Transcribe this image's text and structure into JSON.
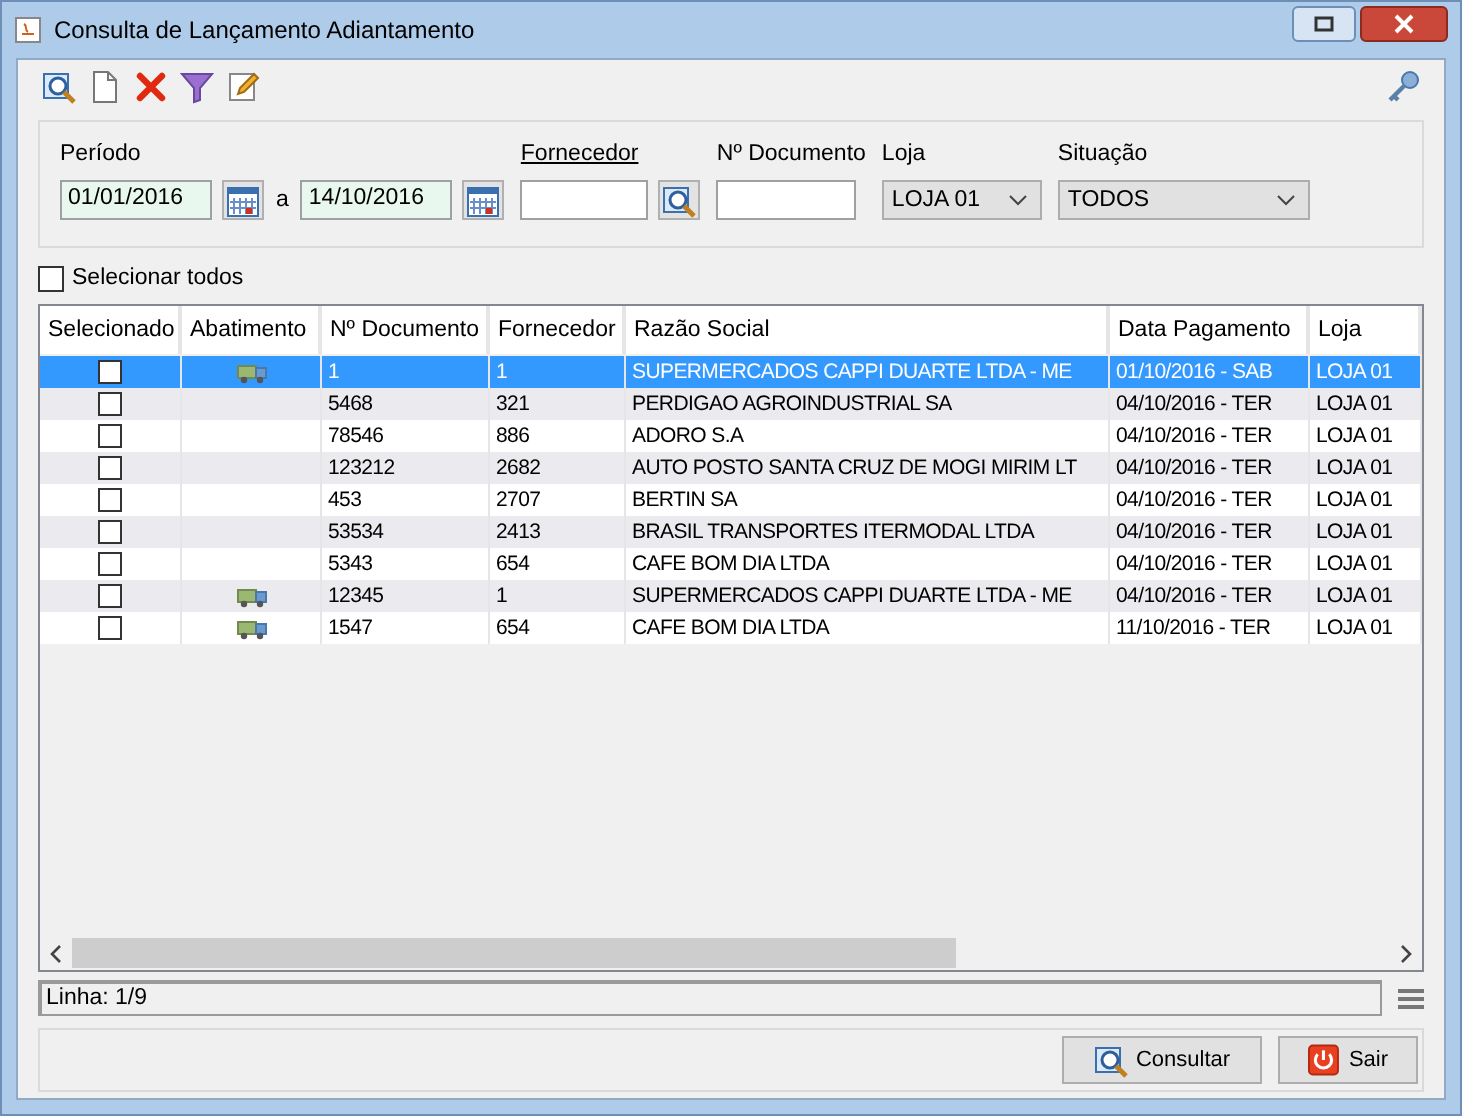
{
  "window": {
    "title": "Consulta de Lançamento Adiantamento"
  },
  "filters": {
    "periodo_label": "Período",
    "date_from": "01/01/2016",
    "between": "a",
    "date_to": "14/10/2016",
    "fornecedor_label": "Fornecedor",
    "documento_label": "Nº Documento",
    "loja_label": "Loja",
    "loja_value": "LOJA 01",
    "situacao_label": "Situação",
    "situacao_value": "TODOS"
  },
  "select_all": {
    "label": "Selecionar todos",
    "checked": false
  },
  "table": {
    "columns": [
      "Selecionado",
      "Abatimento",
      "Nº Documento",
      "Fornecedor",
      "Razão Social",
      "Data Pagamento",
      "Loja"
    ],
    "rows": [
      {
        "selected": true,
        "checked": false,
        "abatimento": true,
        "documento": "1",
        "fornecedor": "1",
        "razao": "SUPERMERCADOS CAPPI DUARTE LTDA - ME",
        "data": "01/10/2016 - SAB",
        "loja": "LOJA 01"
      },
      {
        "selected": false,
        "checked": false,
        "abatimento": false,
        "documento": "5468",
        "fornecedor": "321",
        "razao": "PERDIGAO AGROINDUSTRIAL SA",
        "data": "04/10/2016 - TER",
        "loja": "LOJA 01"
      },
      {
        "selected": false,
        "checked": false,
        "abatimento": false,
        "documento": "78546",
        "fornecedor": "886",
        "razao": "ADORO S.A",
        "data": "04/10/2016 - TER",
        "loja": "LOJA 01"
      },
      {
        "selected": false,
        "checked": false,
        "abatimento": false,
        "documento": "123212",
        "fornecedor": "2682",
        "razao": "AUTO POSTO SANTA CRUZ DE MOGI MIRIM LT",
        "data": "04/10/2016 - TER",
        "loja": "LOJA 01"
      },
      {
        "selected": false,
        "checked": false,
        "abatimento": false,
        "documento": "453",
        "fornecedor": "2707",
        "razao": "BERTIN SA",
        "data": "04/10/2016 - TER",
        "loja": "LOJA 01"
      },
      {
        "selected": false,
        "checked": false,
        "abatimento": false,
        "documento": "53534",
        "fornecedor": "2413",
        "razao": "BRASIL TRANSPORTES ITERMODAL LTDA",
        "data": "04/10/2016 - TER",
        "loja": "LOJA 01"
      },
      {
        "selected": false,
        "checked": false,
        "abatimento": false,
        "documento": "5343",
        "fornecedor": "654",
        "razao": "CAFE BOM DIA LTDA",
        "data": "04/10/2016 - TER",
        "loja": "LOJA 01"
      },
      {
        "selected": false,
        "checked": false,
        "abatimento": true,
        "documento": "12345",
        "fornecedor": "1",
        "razao": "SUPERMERCADOS CAPPI DUARTE LTDA - ME",
        "data": "04/10/2016 - TER",
        "loja": "LOJA 01"
      },
      {
        "selected": false,
        "checked": false,
        "abatimento": true,
        "documento": "1547",
        "fornecedor": "654",
        "razao": "CAFE BOM DIA LTDA",
        "data": "11/10/2016 - TER",
        "loja": "LOJA 01"
      }
    ]
  },
  "status_bar": {
    "text": "Linha: 1/9"
  },
  "buttons": [
    {
      "kind": "consultar",
      "label": "Consultar"
    },
    {
      "kind": "sair",
      "label": "Sair"
    }
  ]
}
